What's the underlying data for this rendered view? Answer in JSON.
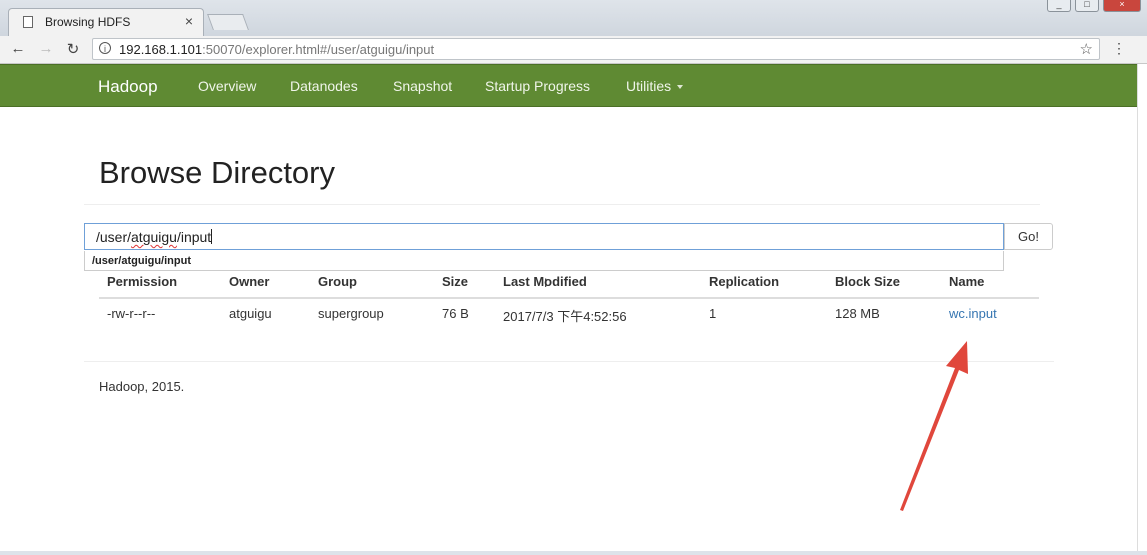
{
  "browser": {
    "tab_title": "Browsing HDFS",
    "tab_close": "×",
    "url_host": "192.168.1.101",
    "url_rest": ":50070/explorer.html#/user/atguigu/input",
    "back_icon": "←",
    "forward_icon": "→",
    "reload_icon": "↻",
    "info_icon": "i",
    "star_icon": "☆",
    "menu_icon": "⋮",
    "window_buttons": {
      "minimize": "_",
      "maximize": "□",
      "close": "×"
    }
  },
  "navbar": {
    "brand": "Hadoop",
    "items": [
      "Overview",
      "Datanodes",
      "Snapshot",
      "Startup Progress",
      "Utilities"
    ],
    "background": "#5f8a33"
  },
  "page": {
    "title": "Browse Directory",
    "path_prefix": "/user/",
    "path_misspelled": "atguigu",
    "path_suffix": "/input",
    "go_label": "Go!",
    "suggestion": "/user/atguigu/input"
  },
  "table": {
    "headers": [
      "Permission",
      "Owner",
      "Group",
      "Size",
      "Last Modified",
      "Replication",
      "Block Size",
      "Name"
    ],
    "rows": [
      [
        "-rw-r--r--",
        "atguigu",
        "supergroup",
        "76 B",
        "2017/7/3 下午4:52:56",
        "1",
        "128 MB",
        "wc.input"
      ]
    ],
    "link_color": "#3575b1"
  },
  "footer": {
    "text": "Hadoop, 2015."
  },
  "annotation": {
    "arrow_color": "#e0473c"
  }
}
